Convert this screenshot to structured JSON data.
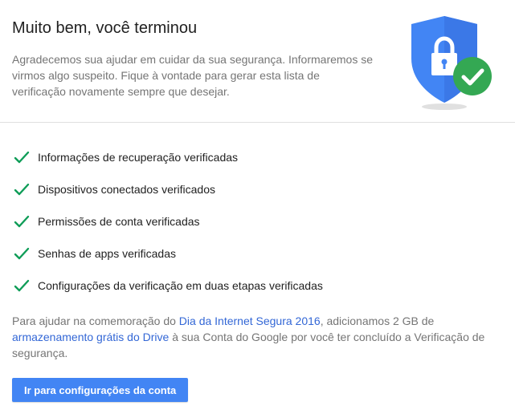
{
  "header": {
    "title": "Muito bem, você terminou",
    "intro": "Agradecemos sua ajudar em cuidar da sua segurança. Informaremos se virmos algo suspeito. Fique à vontade para gerar esta lista de verificação novamente sempre que desejar.",
    "illustration_icon": "shield-lock-check-icon"
  },
  "checklist": [
    {
      "label": "Informações de recuperação verificadas",
      "icon": "checkmark-icon"
    },
    {
      "label": "Dispositivos conectados verificados",
      "icon": "checkmark-icon"
    },
    {
      "label": "Permissões de conta verificadas",
      "icon": "checkmark-icon"
    },
    {
      "label": "Senhas de apps verificadas",
      "icon": "checkmark-icon"
    },
    {
      "label": "Configurações da verificação em duas etapas verificadas",
      "icon": "checkmark-icon"
    }
  ],
  "promo": {
    "text_1": "Para ajudar na comemoração do ",
    "link_1": "Dia da Internet Segura 2016",
    "text_2": ", adicionamos 2 GB de ",
    "link_2": "armazenamento grátis do Drive",
    "text_3": " à sua Conta do Google por você ter concluído a Verificação de segurança."
  },
  "actions": {
    "account_settings_button": "Ir para configurações da conta"
  },
  "colors": {
    "shield_blue": "#4285f4",
    "check_green": "#34a853",
    "checklist_green": "#0f9d58",
    "link_blue": "#3367d6",
    "button_blue": "#4285f4"
  }
}
